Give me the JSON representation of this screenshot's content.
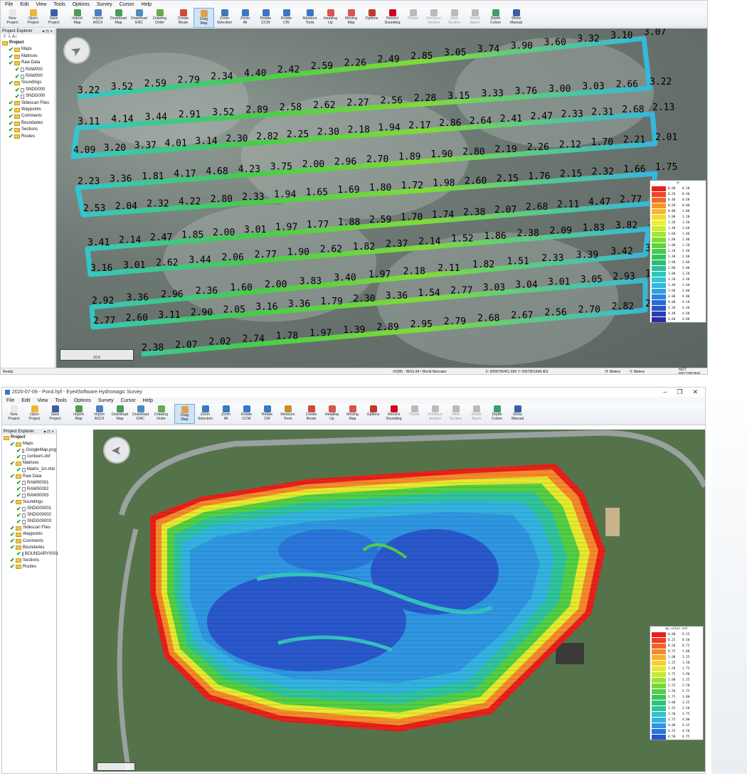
{
  "menu": [
    "File",
    "Edit",
    "View",
    "Tools",
    "Options",
    "Survey",
    "Cursor",
    "Help"
  ],
  "toolbar": [
    {
      "label": "New\nProject",
      "icon": "new-project-icon",
      "color": "#e8e8e8",
      "state": "normal"
    },
    {
      "label": "Open\nProject",
      "icon": "open-project-icon",
      "color": "#f0b43c",
      "state": "normal"
    },
    {
      "label": "Save\nProject",
      "icon": "save-project-icon",
      "color": "#3a5fa8",
      "state": "normal"
    },
    {
      "label": "Import\nMap",
      "icon": "import-map-icon",
      "color": "#4c9a55",
      "state": "normal"
    },
    {
      "label": "Import\nASCII",
      "icon": "import-ascii-icon",
      "color": "#4c7fbf",
      "state": "normal"
    },
    {
      "label": "Download\nMap",
      "icon": "download-map-icon",
      "color": "#4c9a55",
      "state": "normal"
    },
    {
      "label": "Download\nENC",
      "icon": "download-enc-icon",
      "color": "#4c8abf",
      "state": "normal"
    },
    {
      "label": "Drawing\nOrder",
      "icon": "drawing-order-icon",
      "color": "#6aa84f",
      "state": "normal"
    },
    {
      "label": "Create\nRoute",
      "icon": "create-route-icon",
      "color": "#d04a3a",
      "state": "normal"
    },
    {
      "label": "Drag\nMap",
      "icon": "drag-map-icon",
      "color": "#e0a050",
      "state": "active"
    },
    {
      "label": "Zoom\nSelection",
      "icon": "zoom-selection-icon",
      "color": "#3a78c2",
      "state": "normal"
    },
    {
      "label": "Zoom\nAll",
      "icon": "zoom-all-icon",
      "color": "#3a78c2",
      "state": "normal"
    },
    {
      "label": "Rotate\nCCW",
      "icon": "rotate-ccw-icon",
      "color": "#3a78c2",
      "state": "normal"
    },
    {
      "label": "Rotate\nCW",
      "icon": "rotate-cw-icon",
      "color": "#3a78c2",
      "state": "normal"
    },
    {
      "label": "Measure\nTools",
      "icon": "measure-tools-icon",
      "color": "#3a78c2",
      "state": "normal"
    },
    {
      "label": "Heading\nUp",
      "icon": "heading-up-icon",
      "color": "#d9534f",
      "state": "normal"
    },
    {
      "label": "Moving\nMap",
      "icon": "moving-map-icon",
      "color": "#d9534f",
      "state": "normal"
    },
    {
      "label": "Options",
      "icon": "options-icon",
      "color": "#c0392b",
      "state": "normal"
    },
    {
      "label": "Record\nSounding",
      "icon": "record-sounding-icon",
      "color": "#d0021b",
      "state": "normal"
    },
    {
      "label": "Pause",
      "icon": "pause-icon",
      "color": "#bbbbbb",
      "state": "disabled"
    },
    {
      "label": "Previous\nSection",
      "icon": "previous-section-icon",
      "color": "#bbbbbb",
      "state": "disabled"
    },
    {
      "label": "Next\nSection",
      "icon": "next-section-icon",
      "color": "#bbbbbb",
      "state": "disabled"
    },
    {
      "label": "Reset\nAlarm",
      "icon": "reset-alarm-icon",
      "color": "#bbbbbb",
      "state": "disabled"
    },
    {
      "label": "Depth\nColors",
      "icon": "depth-colors-icon",
      "color": "#3aa06a",
      "state": "normal"
    },
    {
      "label": "Show\nManual",
      "icon": "show-manual-icon",
      "color": "#3a5fa8",
      "state": "normal"
    }
  ],
  "toolbar2": [
    {
      "label": "New\nProject",
      "icon": "new-project-icon",
      "color": "#e8e8e8",
      "state": "normal"
    },
    {
      "label": "Open\nProject",
      "icon": "open-project-icon",
      "color": "#f0b43c",
      "state": "normal"
    },
    {
      "label": "Save\nProject",
      "icon": "save-project-icon",
      "color": "#3a5fa8",
      "state": "normal"
    },
    {
      "label": "Import\nMap",
      "icon": "import-map-icon",
      "color": "#4c9a55",
      "state": "normal"
    },
    {
      "label": "Import\nASCII",
      "icon": "import-ascii-icon",
      "color": "#4c7fbf",
      "state": "normal"
    },
    {
      "label": "Download\nMap",
      "icon": "download-map-icon",
      "color": "#4c9a55",
      "state": "normal"
    },
    {
      "label": "Download\nENC",
      "icon": "download-enc-icon",
      "color": "#4c8abf",
      "state": "normal"
    },
    {
      "label": "Drawing\nOrder",
      "icon": "drawing-order-icon",
      "color": "#6aa84f",
      "state": "normal"
    },
    {
      "label": "Drag\nMap",
      "icon": "drag-map-icon",
      "color": "#e0a050",
      "state": "active"
    },
    {
      "label": "Zoom\nSelection",
      "icon": "zoom-selection-icon",
      "color": "#3a78c2",
      "state": "normal"
    },
    {
      "label": "Zoom\nAll",
      "icon": "zoom-all-icon",
      "color": "#3a78c2",
      "state": "normal"
    },
    {
      "label": "Rotate\nCCW",
      "icon": "rotate-ccw-icon",
      "color": "#3a78c2",
      "state": "normal"
    },
    {
      "label": "Rotate\nCW",
      "icon": "rotate-cw-icon",
      "color": "#3a78c2",
      "state": "normal"
    },
    {
      "label": "Measure\nTools",
      "icon": "measure-tools-icon",
      "color": "#d08a2a",
      "state": "normal"
    },
    {
      "label": "Create\nRoute",
      "icon": "create-route-icon",
      "color": "#d04a3a",
      "state": "normal"
    },
    {
      "label": "Heading\nUp",
      "icon": "heading-up-icon",
      "color": "#d9534f",
      "state": "normal"
    },
    {
      "label": "Moving\nMap",
      "icon": "moving-map-icon",
      "color": "#d9534f",
      "state": "normal"
    },
    {
      "label": "Options",
      "icon": "options-icon",
      "color": "#c0392b",
      "state": "normal"
    },
    {
      "label": "Record\nSounding",
      "icon": "record-sounding-icon",
      "color": "#d0021b",
      "state": "normal"
    },
    {
      "label": "Pause",
      "icon": "pause-icon",
      "color": "#bbbbbb",
      "state": "disabled"
    },
    {
      "label": "Previous\nSection",
      "icon": "previous-section-icon",
      "color": "#bbbbbb",
      "state": "disabled"
    },
    {
      "label": "Next\nSection",
      "icon": "next-section-icon",
      "color": "#bbbbbb",
      "state": "disabled"
    },
    {
      "label": "Reset\nAlarm",
      "icon": "reset-alarm-icon",
      "color": "#bbbbbb",
      "state": "disabled"
    },
    {
      "label": "Depth\nColors",
      "icon": "depth-colors-icon",
      "color": "#3aa06a",
      "state": "normal"
    },
    {
      "label": "Show\nManual",
      "icon": "show-manual-icon",
      "color": "#3a5fa8",
      "state": "normal"
    }
  ],
  "explorer": {
    "title": "Project Explorer",
    "pin": "▾ ⊓ ×"
  },
  "tree1": [
    {
      "label": "Project",
      "level": 0,
      "kind": "project"
    },
    {
      "label": "Maps",
      "level": 1,
      "kind": "folder"
    },
    {
      "label": "Matrices",
      "level": 1,
      "kind": "folder"
    },
    {
      "label": "Raw Data",
      "level": 1,
      "kind": "folder"
    },
    {
      "label": "RAW000",
      "level": 2,
      "kind": "doc"
    },
    {
      "label": "RAW000",
      "level": 2,
      "kind": "doc"
    },
    {
      "label": "Soundings",
      "level": 1,
      "kind": "folder"
    },
    {
      "label": "SNDG000",
      "level": 2,
      "kind": "doc"
    },
    {
      "label": "SNDG000",
      "level": 2,
      "kind": "doc"
    },
    {
      "label": "Sidescan Files",
      "level": 1,
      "kind": "folder"
    },
    {
      "label": "Waypoints",
      "level": 1,
      "kind": "folder"
    },
    {
      "label": "Comments",
      "level": 1,
      "kind": "folder"
    },
    {
      "label": "Boundaries",
      "level": 1,
      "kind": "folder"
    },
    {
      "label": "Sections",
      "level": 1,
      "kind": "folder"
    },
    {
      "label": "Routes",
      "level": 1,
      "kind": "folder"
    }
  ],
  "tree2": [
    {
      "label": "Project",
      "level": 0,
      "kind": "project"
    },
    {
      "label": "Maps",
      "level": 1,
      "kind": "folder"
    },
    {
      "label": "GoogleMap.png",
      "level": 2,
      "kind": "doc"
    },
    {
      "label": "contours.dxf",
      "level": 2,
      "kind": "doc"
    },
    {
      "label": "Matrices",
      "level": 1,
      "kind": "folder"
    },
    {
      "label": "Matrix_1m.mtx",
      "level": 2,
      "kind": "doc"
    },
    {
      "label": "Raw Data",
      "level": 1,
      "kind": "folder"
    },
    {
      "label": "RAW00001",
      "level": 2,
      "kind": "doc"
    },
    {
      "label": "RAW00002",
      "level": 2,
      "kind": "doc"
    },
    {
      "label": "RAW00003",
      "level": 2,
      "kind": "doc"
    },
    {
      "label": "Soundings",
      "level": 1,
      "kind": "folder"
    },
    {
      "label": "SNDG00001",
      "level": 2,
      "kind": "doc"
    },
    {
      "label": "SNDG00002",
      "level": 2,
      "kind": "doc"
    },
    {
      "label": "SNDG00003",
      "level": 2,
      "kind": "doc"
    },
    {
      "label": "Sidescan Files",
      "level": 1,
      "kind": "folder"
    },
    {
      "label": "Waypoints",
      "level": 1,
      "kind": "folder"
    },
    {
      "label": "Comments",
      "level": 1,
      "kind": "folder"
    },
    {
      "label": "Boundaries",
      "level": 1,
      "kind": "folder"
    },
    {
      "label": "BOUNDARY0001",
      "level": 2,
      "kind": "doc"
    },
    {
      "label": "Sections",
      "level": 1,
      "kind": "folder"
    },
    {
      "label": "Routes",
      "level": 1,
      "kind": "folder"
    }
  ],
  "window2": {
    "title": "2020-07-09 - Pond.hpf - Eye4Software Hydromagic Survey",
    "controls": [
      "–",
      "❐",
      "✕"
    ]
  },
  "status1": {
    "left": "Ready",
    "projection": "#3395 - WGS 84 / World Mercator",
    "xy": "X: 0058795451.656  Y: 0057851698.401",
    "h": "H: Meters",
    "v": "V: Meters",
    "rec": "NOT RECORDING"
  },
  "scale1": "10.0",
  "scale2": "",
  "legend1": {
    "title": "м",
    "rows": [
      [
        "0.00",
        "0.20",
        "#e8211b"
      ],
      [
        "0.20",
        "0.40",
        "#f0442a"
      ],
      [
        "0.40",
        "0.60",
        "#f26a28"
      ],
      [
        "0.60",
        "0.80",
        "#f5922a"
      ],
      [
        "0.80",
        "1.00",
        "#f8b52b"
      ],
      [
        "1.00",
        "1.20",
        "#f5d92c"
      ],
      [
        "1.20",
        "1.40",
        "#e9ef2c"
      ],
      [
        "1.40",
        "1.60",
        "#c9ee2e"
      ],
      [
        "1.60",
        "1.80",
        "#a4e632"
      ],
      [
        "1.80",
        "2.00",
        "#7fdc36"
      ],
      [
        "2.00",
        "2.20",
        "#5ed43a"
      ],
      [
        "2.20",
        "2.40",
        "#45cc4a"
      ],
      [
        "2.40",
        "2.60",
        "#33c45e"
      ],
      [
        "2.60",
        "2.80",
        "#2bbd77"
      ],
      [
        "2.80",
        "3.00",
        "#2bc29a"
      ],
      [
        "3.00",
        "3.20",
        "#2ec7ba"
      ],
      [
        "3.20",
        "3.40",
        "#33c6d1"
      ],
      [
        "3.40",
        "3.60",
        "#33b7df"
      ],
      [
        "3.60",
        "3.80",
        "#2fa0e3"
      ],
      [
        "3.80",
        "4.00",
        "#2a86df"
      ],
      [
        "4.00",
        "4.20",
        "#2a6ad6"
      ],
      [
        "4.20",
        "4.40",
        "#2a52c8"
      ],
      [
        "4.40",
        "4.60",
        "#2a3db8"
      ],
      [
        "4.60",
        "4.80",
        "#2a2ca5"
      ]
    ]
  },
  "legend2": {
    "title": "my-color-set",
    "rows": [
      [
        "0.00",
        "0.25",
        "#e8211b"
      ],
      [
        "0.25",
        "0.50",
        "#ef3d24"
      ],
      [
        "0.50",
        "0.75",
        "#f2632a"
      ],
      [
        "0.75",
        "1.00",
        "#f5892b"
      ],
      [
        "1.00",
        "1.25",
        "#f7ad2c"
      ],
      [
        "1.25",
        "1.50",
        "#f6cf2c"
      ],
      [
        "1.50",
        "1.75",
        "#e6ea2d"
      ],
      [
        "1.75",
        "1.90",
        "#c4eb31"
      ],
      [
        "2.00",
        "2.25",
        "#9de336"
      ],
      [
        "2.25",
        "2.50",
        "#74d83b"
      ],
      [
        "2.50",
        "2.75",
        "#53cf45"
      ],
      [
        "2.75",
        "3.00",
        "#3dc75a"
      ],
      [
        "3.00",
        "3.25",
        "#32c178"
      ],
      [
        "3.25",
        "3.50",
        "#30c49e"
      ],
      [
        "3.50",
        "3.75",
        "#33c4c2"
      ],
      [
        "3.75",
        "4.00",
        "#33b3df"
      ],
      [
        "4.00",
        "4.25",
        "#2f96e2"
      ],
      [
        "4.25",
        "4.50",
        "#2a76db"
      ],
      [
        "4.50",
        "4.75",
        "#2a58cc"
      ]
    ]
  },
  "track_rows": [
    [
      "3.22",
      "3.52",
      "2.59",
      "2.79",
      "2.34",
      "4.40",
      "2.42",
      "2.59",
      "2.26",
      "2.49",
      "2.85",
      "3.05",
      "3.74",
      "3.90",
      "3.60",
      "3.32",
      "3.10",
      "3.07"
    ],
    [
      "3.11",
      "4.14",
      "3.44",
      "2.91",
      "3.52",
      "2.89",
      "2.58",
      "2.62",
      "2.27",
      "2.56",
      "2.28",
      "3.15",
      "3.33",
      "3.76",
      "3.00",
      "3.03",
      "2.66",
      "3.22"
    ],
    [
      "4.09",
      "3.20",
      "3.37",
      "4.01",
      "3.14",
      "2.30",
      "2.82",
      "2.25",
      "2.30",
      "2.18",
      "1.94",
      "2.17",
      "2.86",
      "2.64",
      "2.41",
      "2.47",
      "2.33",
      "2.31",
      "2.68",
      "2.13"
    ],
    [
      "2.23",
      "3.36",
      "1.81",
      "4.17",
      "4.68",
      "4.23",
      "3.75",
      "2.00",
      "2.96",
      "2.70",
      "1.89",
      "1.90",
      "2.80",
      "2.19",
      "2.26",
      "2.12",
      "1.70",
      "2.21",
      "2.01"
    ],
    [
      "2.53",
      "2.04",
      "2.32",
      "4.22",
      "2.80",
      "2.33",
      "1.94",
      "1.65",
      "1.69",
      "1.80",
      "1.72",
      "1.98",
      "2.60",
      "2.15",
      "1.76",
      "2.15",
      "2.32",
      "1.66",
      "1.75"
    ],
    [
      "3.41",
      "2.14",
      "2.47",
      "1.85",
      "2.00",
      "3.01",
      "1.97",
      "1.77",
      "1.88",
      "2.59",
      "1.70",
      "1.74",
      "2.38",
      "2.07",
      "2.68",
      "2.11",
      "4.47",
      "2.77",
      "3.35"
    ],
    [
      "3.16",
      "3.01",
      "2.62",
      "3.44",
      "2.06",
      "2.77",
      "1.90",
      "2.62",
      "1.82",
      "2.37",
      "2.14",
      "1.52",
      "1.86",
      "2.38",
      "2.09",
      "1.83",
      "3.82",
      "2.42"
    ],
    [
      "2.92",
      "3.36",
      "2.96",
      "2.36",
      "1.60",
      "2.00",
      "3.83",
      "3.40",
      "1.97",
      "2.18",
      "2.11",
      "1.82",
      "1.51",
      "2.33",
      "3.39",
      "3.42",
      "3.62"
    ],
    [
      "2.77",
      "2.60",
      "3.11",
      "2.90",
      "2.05",
      "3.16",
      "3.36",
      "1.79",
      "2.30",
      "3.36",
      "1.54",
      "2.77",
      "3.03",
      "3.04",
      "3.01",
      "3.05",
      "2.93",
      "1.84"
    ],
    [
      "2.38",
      "2.07",
      "2.02",
      "2.74",
      "1.78",
      "1.97",
      "1.39",
      "2.89",
      "2.95",
      "2.79",
      "2.68",
      "2.67",
      "2.56",
      "2.70",
      "2.82",
      "2.43"
    ]
  ]
}
